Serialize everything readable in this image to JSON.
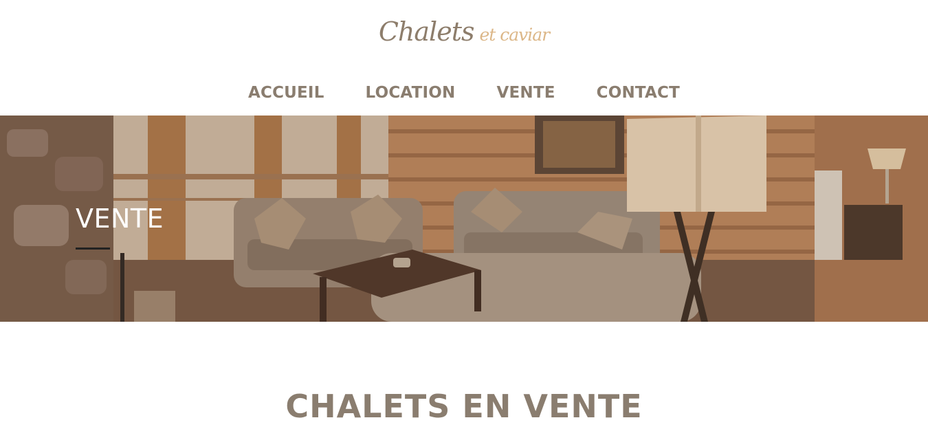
{
  "logo": {
    "main": "Chalets",
    "accent": "et caviar"
  },
  "nav": {
    "items": [
      "ACCUEIL",
      "LOCATION",
      "VENTE",
      "CONTACT"
    ]
  },
  "hero": {
    "title": "VENTE"
  },
  "section": {
    "title": "CHALETS EN VENTE"
  },
  "colors": {
    "brand": "#8a7d6f",
    "accent": "#dcb788",
    "hero_title": "#ffffff"
  }
}
